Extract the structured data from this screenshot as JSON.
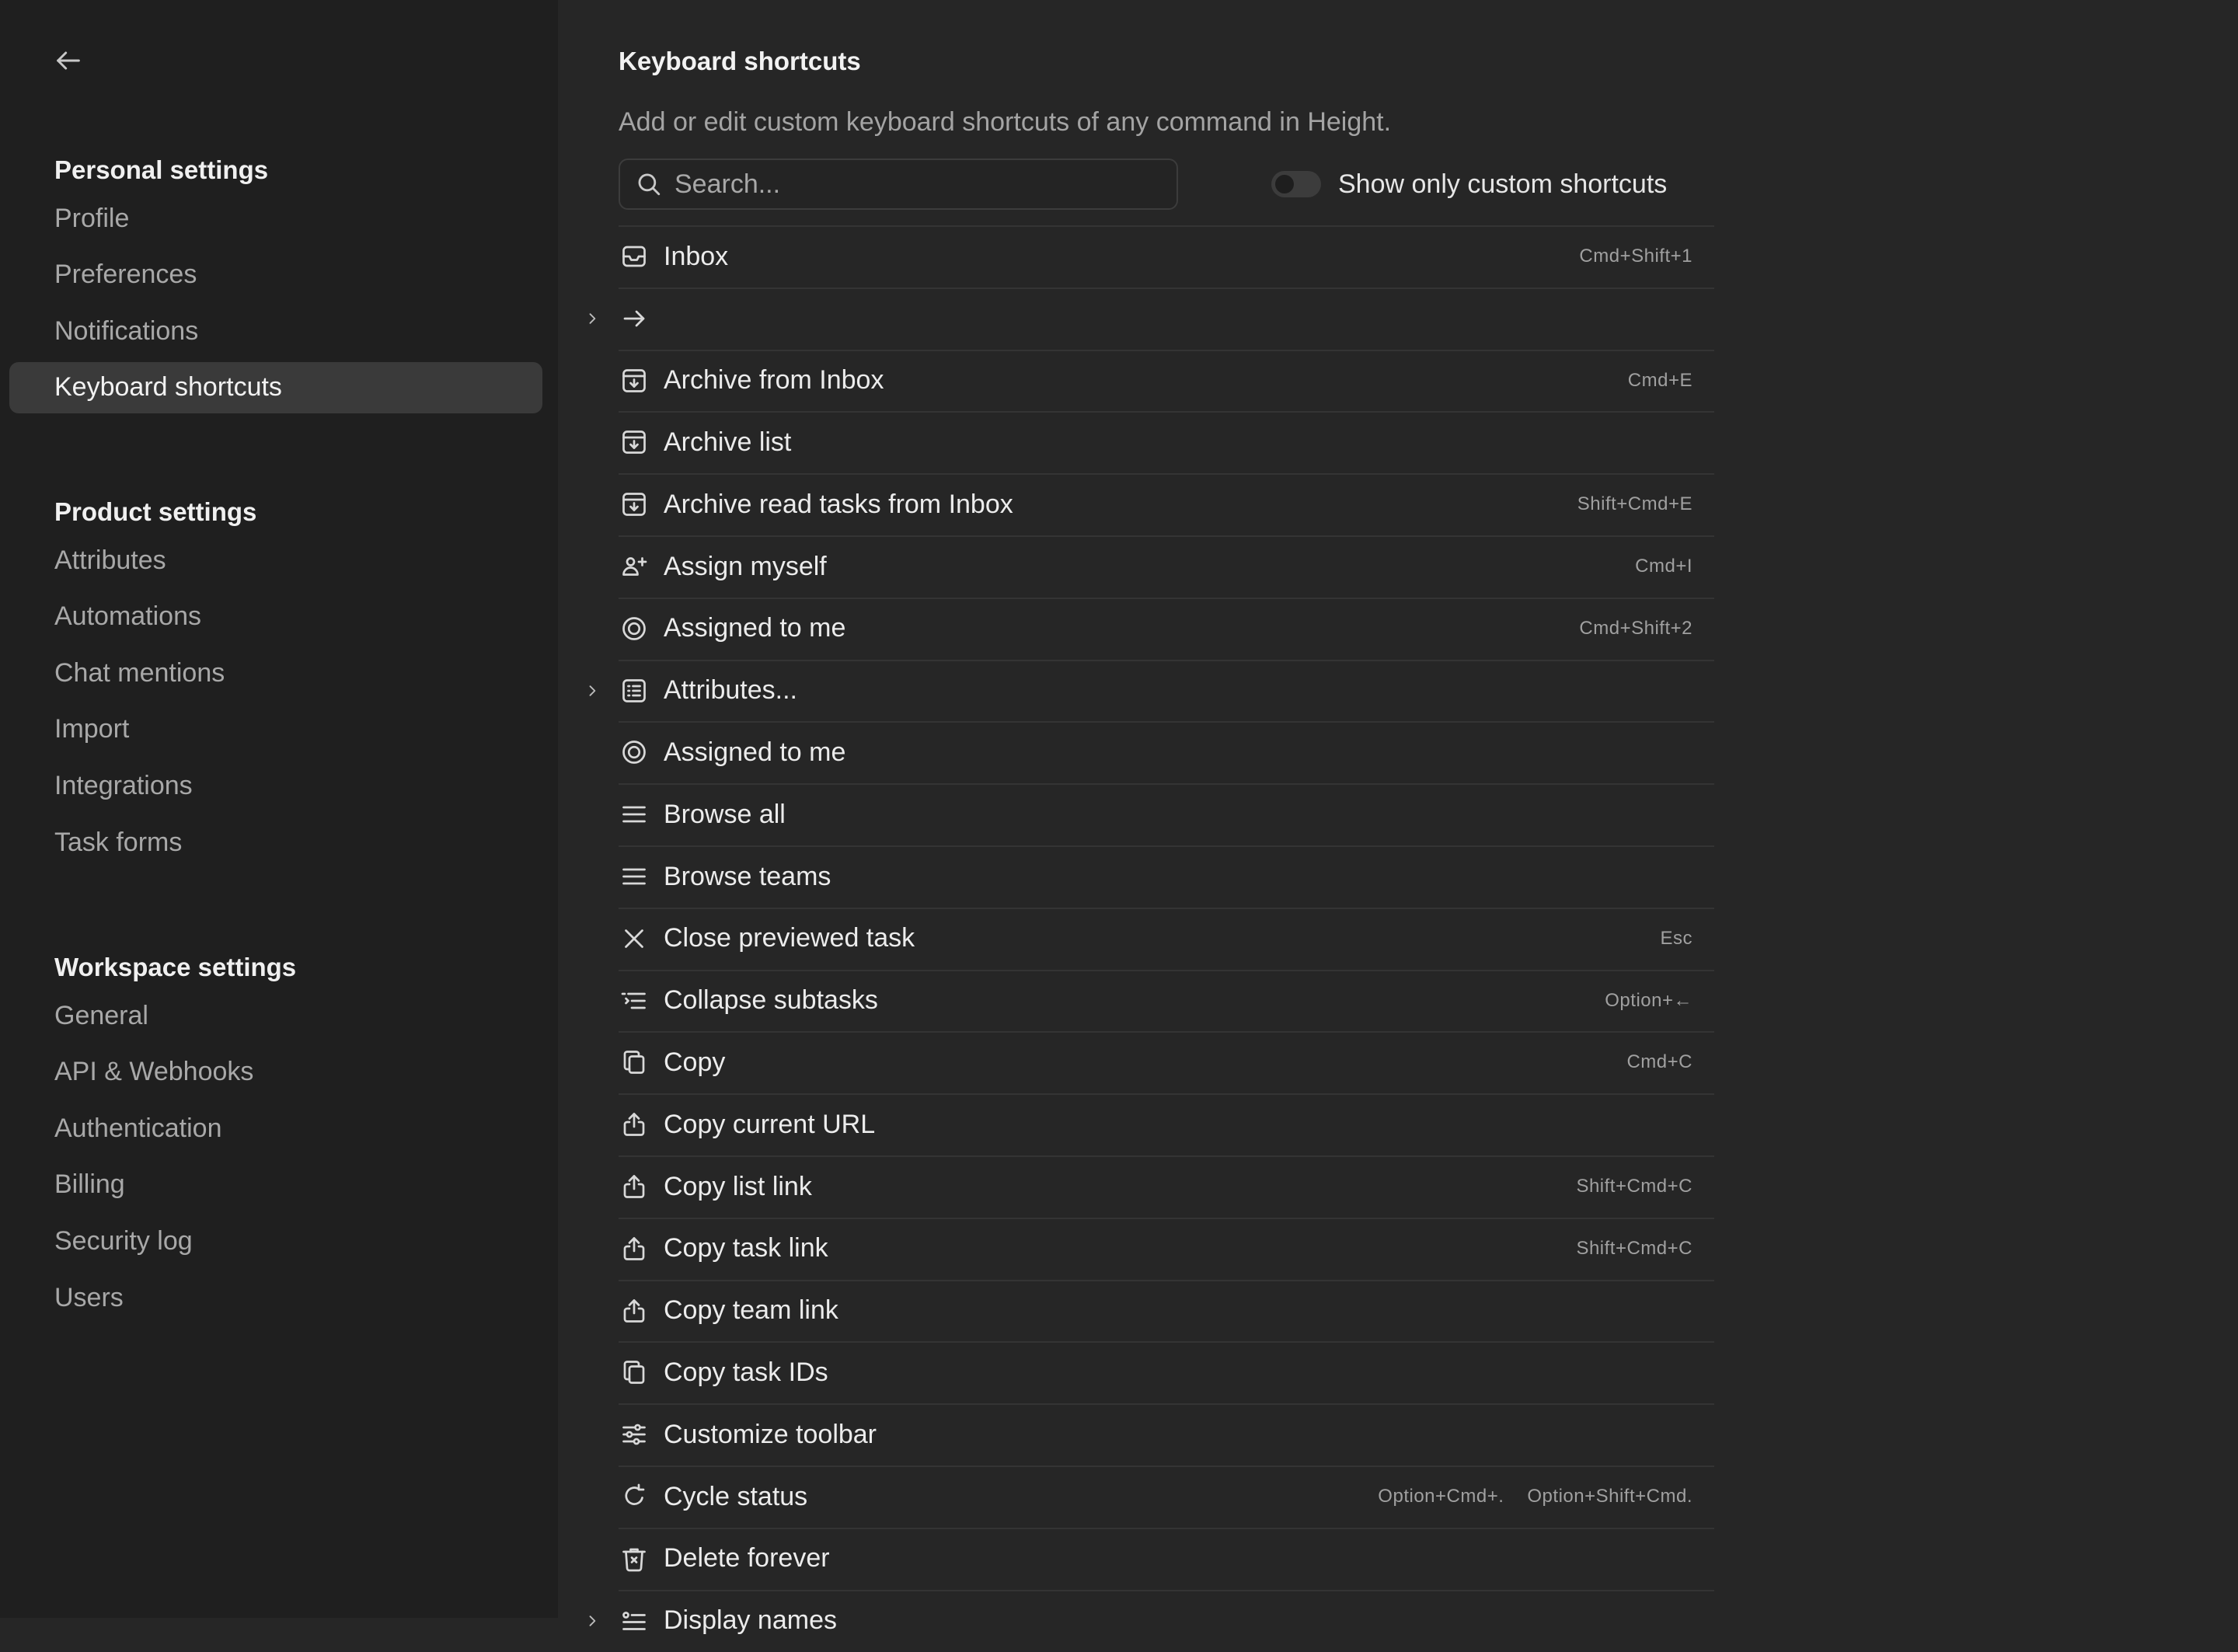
{
  "sidebar": {
    "sections": [
      {
        "title": "Personal settings",
        "items": [
          {
            "label": "Profile"
          },
          {
            "label": "Preferences"
          },
          {
            "label": "Notifications"
          },
          {
            "label": "Keyboard shortcuts",
            "active": true
          }
        ]
      },
      {
        "title": "Product settings",
        "items": [
          {
            "label": "Attributes"
          },
          {
            "label": "Automations"
          },
          {
            "label": "Chat mentions"
          },
          {
            "label": "Import"
          },
          {
            "label": "Integrations"
          },
          {
            "label": "Task forms"
          }
        ]
      },
      {
        "title": "Workspace settings",
        "items": [
          {
            "label": "General"
          },
          {
            "label": "API & Webhooks"
          },
          {
            "label": "Authentication"
          },
          {
            "label": "Billing"
          },
          {
            "label": "Security log"
          },
          {
            "label": "Users"
          }
        ]
      }
    ]
  },
  "main": {
    "title": "Keyboard shortcuts",
    "description": "Add or edit custom keyboard shortcuts of any command in Height.",
    "search": {
      "placeholder": "Search..."
    },
    "toggle_label": "Show only custom shortcuts",
    "commands": [
      {
        "icon": "inbox",
        "label": "Inbox",
        "shortcuts": [
          "Cmd+Shift+1"
        ]
      },
      {
        "icon": "arrow-right",
        "label": "",
        "expandable": true,
        "shortcuts": []
      },
      {
        "icon": "archive",
        "label": "Archive from Inbox",
        "shortcuts": [
          "Cmd+E"
        ]
      },
      {
        "icon": "archive",
        "label": "Archive list",
        "shortcuts": []
      },
      {
        "icon": "archive",
        "label": "Archive read tasks from Inbox",
        "shortcuts": [
          "Shift+Cmd+E"
        ]
      },
      {
        "icon": "assign-user",
        "label": "Assign myself",
        "shortcuts": [
          "Cmd+I"
        ]
      },
      {
        "icon": "target",
        "label": "Assigned to me",
        "shortcuts": [
          "Cmd+Shift+2"
        ]
      },
      {
        "icon": "list-box",
        "label": "Attributes...",
        "expandable": true,
        "shortcuts": []
      },
      {
        "icon": "target",
        "label": "Assigned to me",
        "shortcuts": []
      },
      {
        "icon": "menu",
        "label": "Browse all",
        "shortcuts": []
      },
      {
        "icon": "menu",
        "label": "Browse teams",
        "shortcuts": []
      },
      {
        "icon": "close",
        "label": "Close previewed task",
        "shortcuts": [
          "Esc"
        ]
      },
      {
        "icon": "collapse-list",
        "label": "Collapse subtasks",
        "shortcuts": [
          "Option+←"
        ]
      },
      {
        "icon": "copy",
        "label": "Copy",
        "shortcuts": [
          "Cmd+C"
        ]
      },
      {
        "icon": "share",
        "label": "Copy current URL",
        "shortcuts": []
      },
      {
        "icon": "share",
        "label": "Copy list link",
        "shortcuts": [
          "Shift+Cmd+C"
        ]
      },
      {
        "icon": "share",
        "label": "Copy task link",
        "shortcuts": [
          "Shift+Cmd+C"
        ]
      },
      {
        "icon": "share",
        "label": "Copy team link",
        "shortcuts": []
      },
      {
        "icon": "copy",
        "label": "Copy task IDs",
        "shortcuts": []
      },
      {
        "icon": "sliders",
        "label": "Customize toolbar",
        "shortcuts": []
      },
      {
        "icon": "cycle",
        "label": "Cycle status",
        "shortcuts": [
          "Option+Cmd+.",
          "Option+Shift+Cmd."
        ]
      },
      {
        "icon": "trash",
        "label": "Delete forever",
        "shortcuts": []
      },
      {
        "icon": "display-names",
        "label": "Display names",
        "expandable": true,
        "shortcuts": []
      }
    ]
  }
}
